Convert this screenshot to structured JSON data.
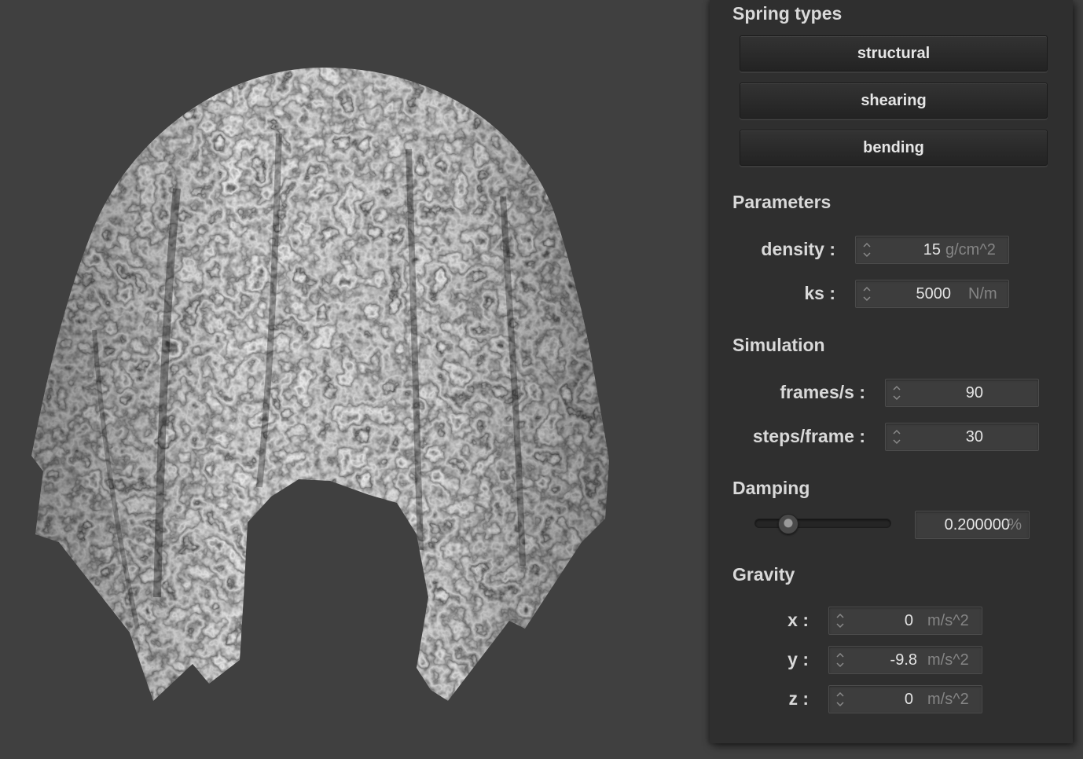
{
  "panel": {
    "spring_types": {
      "title": "Spring types",
      "buttons": [
        "structural",
        "shearing",
        "bending"
      ]
    },
    "parameters": {
      "title": "Parameters",
      "density": {
        "label": "density :",
        "value": "15",
        "unit": "g/cm^2"
      },
      "ks": {
        "label": "ks :",
        "value": "5000",
        "unit": "N/m"
      }
    },
    "simulation": {
      "title": "Simulation",
      "fps": {
        "label": "frames/s :",
        "value": "90"
      },
      "steps": {
        "label": "steps/frame :",
        "value": "30"
      }
    },
    "damping": {
      "title": "Damping",
      "value": "0.200000",
      "unit": "%",
      "slider_fraction": 0.2
    },
    "gravity": {
      "title": "Gravity",
      "x": {
        "label": "x :",
        "value": "0",
        "unit": "m/s^2"
      },
      "y": {
        "label": "y :",
        "value": "-9.8",
        "unit": "m/s^2"
      },
      "z": {
        "label": "z :",
        "value": "0",
        "unit": "m/s^2"
      }
    }
  },
  "colors": {
    "viewport_bg": "#404040",
    "panel_bg": "#2f2f2f",
    "text": "#d9d9d9",
    "unit_text": "#858585"
  }
}
